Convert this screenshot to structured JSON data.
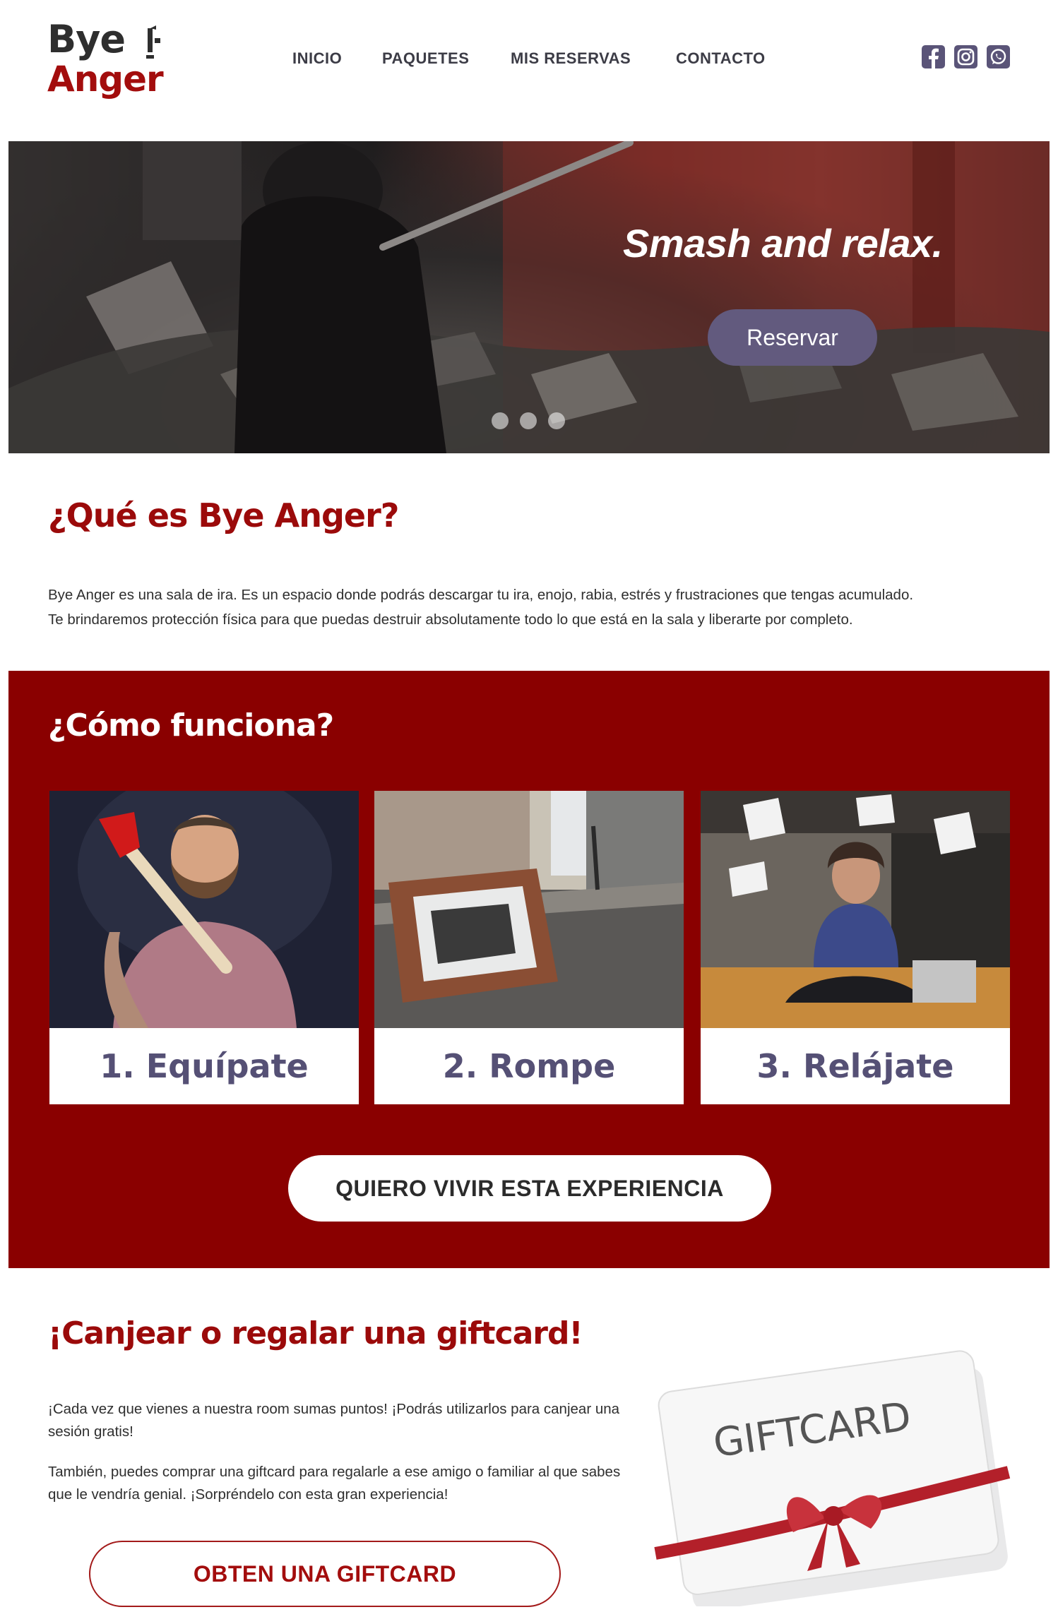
{
  "brand": {
    "logo_line1": "Bye",
    "logo_line2": "Anger",
    "accent_color": "#9b0a0a",
    "button_color": "#625a7e",
    "section_bg": "#8a0000"
  },
  "nav": {
    "items": [
      "INICIO",
      "PAQUETES",
      "MIS RESERVAS",
      "CONTACTO"
    ]
  },
  "social": [
    "facebook-icon",
    "instagram-icon",
    "whatsapp-icon"
  ],
  "hero": {
    "tagline": "Smash and relax.",
    "cta_label": "Reservar",
    "slides": 3
  },
  "about": {
    "title": "¿Qué es Bye Anger?",
    "text_line1": "Bye Anger es una sala de ira. Es un espacio donde podrás descargar tu ira, enojo, rabia, estrés y frustraciones  que tengas acumulado.",
    "text_line2": "Te brindaremos protección física para que puedas destruir absolutamente todo lo que está en la sala y liberarte por completo."
  },
  "how": {
    "title": "¿Cómo funciona?",
    "steps": [
      {
        "label": "1. Equípate"
      },
      {
        "label": "2. Rompe"
      },
      {
        "label": "3. Relájate"
      }
    ],
    "cta_label": "QUIERO VIVIR ESTA EXPERIENCIA"
  },
  "gift": {
    "title": "¡Canjear o regalar una giftcard!",
    "p1": "¡Cada vez que vienes a nuestra room sumas puntos! ¡Podrás utilizarlos para canjear una sesión gratis!",
    "p2": "También, puedes comprar una giftcard para regalarle a ese amigo o familiar al que sabes que le vendría genial. ¡Sorpréndelo con esta gran experiencia!",
    "cta_label": "OBTEN UNA GIFTCARD",
    "card_text": "GIFTCARD"
  }
}
